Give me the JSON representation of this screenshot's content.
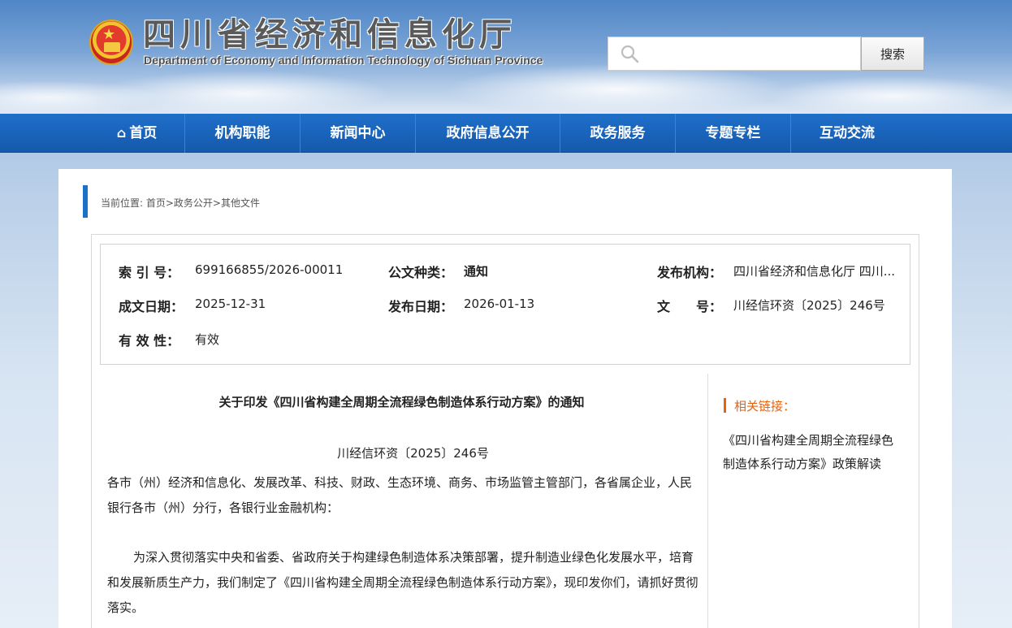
{
  "header": {
    "title": "四川省经济和信息化厅",
    "subtitle": "Department of Economy and Information Technology of Sichuan Province",
    "search": {
      "placeholder": "",
      "button_label": "搜索"
    }
  },
  "nav": {
    "items": [
      {
        "label": "首页",
        "icon": "home-icon"
      },
      {
        "label": "机构职能"
      },
      {
        "label": "新闻中心"
      },
      {
        "label": "政府信息公开"
      },
      {
        "label": "政务服务"
      },
      {
        "label": "专题专栏"
      },
      {
        "label": "互动交流"
      }
    ]
  },
  "breadcrumb": "当前位置: 首页>政务公开>其他文件",
  "meta": {
    "index_label": "索 引 号：",
    "index_value": "699166855/2026-00011",
    "doc_type_label": "公文种类：",
    "doc_type_value": "通知",
    "issuer_label": "发布机构：",
    "issuer_value": "四川省经济和信息化厅 四川...",
    "created_label": "成文日期：",
    "created_value": "2025-12-31",
    "published_label": "发布日期：",
    "published_value": "2026-01-13",
    "docno_label": "文　　号：",
    "docno_value": "川经信环资〔2025〕246号",
    "validity_label": "有 效 性：",
    "validity_value": "有效"
  },
  "document": {
    "title": "关于印发《四川省构建全周期全流程绿色制造体系行动方案》的通知",
    "number": "川经信环资〔2025〕246号",
    "addressee": "各市（州）经济和信息化、发展改革、科技、财政、生态环境、商务、市场监管主管部门，各省属企业，人民银行各市（州）分行，各银行业金融机构：",
    "body": "为深入贯彻落实中央和省委、省政府关于构建绿色制造体系决策部署，提升制造业绿色化发展水平，培育和发展新质生产力，我们制定了《四川省构建全周期全流程绿色制造体系行动方案》，现印发你们，请抓好贯彻落实。"
  },
  "related": {
    "title": "相关链接：",
    "links": [
      "《四川省构建全周期全流程绿色制造体系行动方案》政策解读"
    ]
  },
  "colors": {
    "nav_blue": "#1a64bd",
    "accent_orange": "#e8620e",
    "breadcrumb_blue": "#1d70c8"
  }
}
